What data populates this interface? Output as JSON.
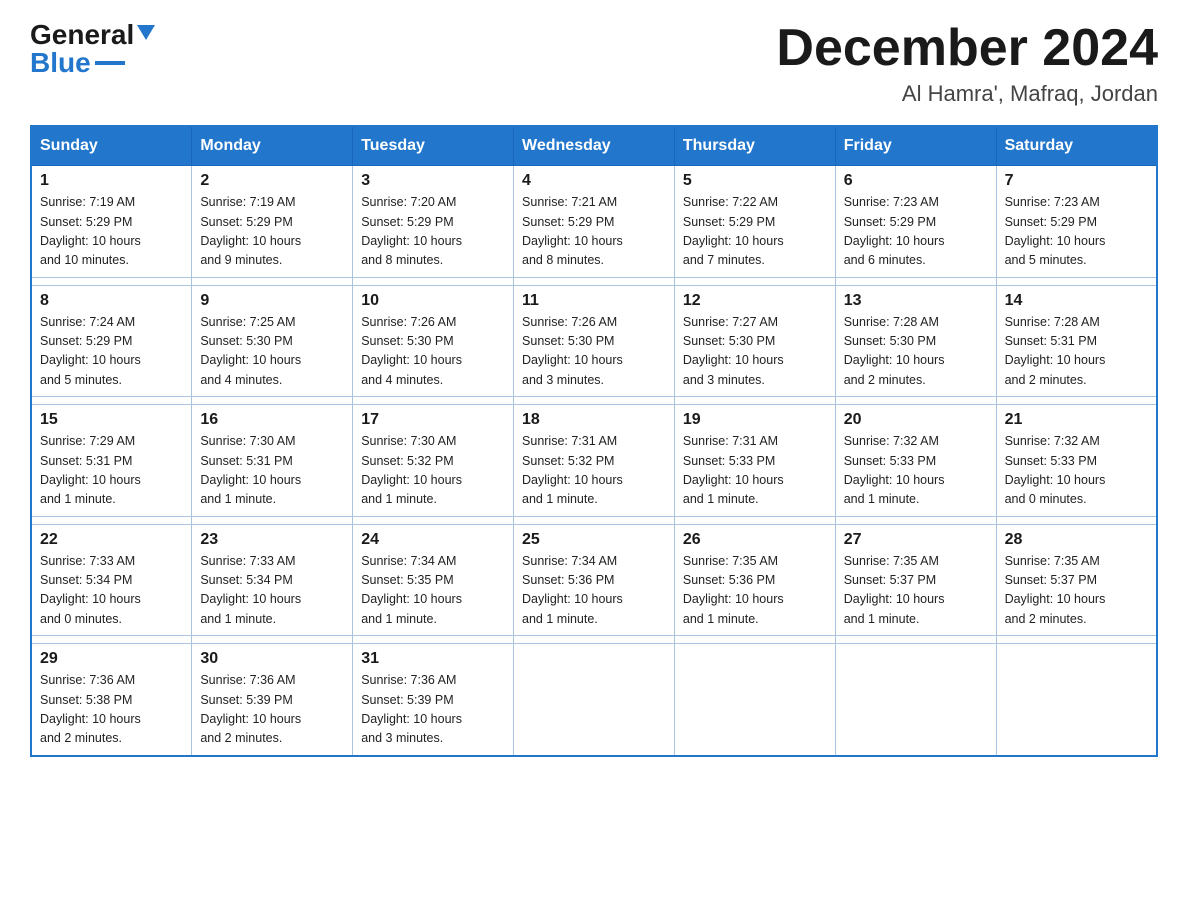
{
  "header": {
    "logo_general": "General",
    "logo_blue": "Blue",
    "title": "December 2024",
    "location": "Al Hamra', Mafraq, Jordan"
  },
  "days_of_week": [
    "Sunday",
    "Monday",
    "Tuesday",
    "Wednesday",
    "Thursday",
    "Friday",
    "Saturday"
  ],
  "weeks": [
    [
      {
        "day": "1",
        "sunrise": "7:19 AM",
        "sunset": "5:29 PM",
        "daylight": "10 hours and 10 minutes."
      },
      {
        "day": "2",
        "sunrise": "7:19 AM",
        "sunset": "5:29 PM",
        "daylight": "10 hours and 9 minutes."
      },
      {
        "day": "3",
        "sunrise": "7:20 AM",
        "sunset": "5:29 PM",
        "daylight": "10 hours and 8 minutes."
      },
      {
        "day": "4",
        "sunrise": "7:21 AM",
        "sunset": "5:29 PM",
        "daylight": "10 hours and 8 minutes."
      },
      {
        "day": "5",
        "sunrise": "7:22 AM",
        "sunset": "5:29 PM",
        "daylight": "10 hours and 7 minutes."
      },
      {
        "day": "6",
        "sunrise": "7:23 AM",
        "sunset": "5:29 PM",
        "daylight": "10 hours and 6 minutes."
      },
      {
        "day": "7",
        "sunrise": "7:23 AM",
        "sunset": "5:29 PM",
        "daylight": "10 hours and 5 minutes."
      }
    ],
    [
      {
        "day": "8",
        "sunrise": "7:24 AM",
        "sunset": "5:29 PM",
        "daylight": "10 hours and 5 minutes."
      },
      {
        "day": "9",
        "sunrise": "7:25 AM",
        "sunset": "5:30 PM",
        "daylight": "10 hours and 4 minutes."
      },
      {
        "day": "10",
        "sunrise": "7:26 AM",
        "sunset": "5:30 PM",
        "daylight": "10 hours and 4 minutes."
      },
      {
        "day": "11",
        "sunrise": "7:26 AM",
        "sunset": "5:30 PM",
        "daylight": "10 hours and 3 minutes."
      },
      {
        "day": "12",
        "sunrise": "7:27 AM",
        "sunset": "5:30 PM",
        "daylight": "10 hours and 3 minutes."
      },
      {
        "day": "13",
        "sunrise": "7:28 AM",
        "sunset": "5:30 PM",
        "daylight": "10 hours and 2 minutes."
      },
      {
        "day": "14",
        "sunrise": "7:28 AM",
        "sunset": "5:31 PM",
        "daylight": "10 hours and 2 minutes."
      }
    ],
    [
      {
        "day": "15",
        "sunrise": "7:29 AM",
        "sunset": "5:31 PM",
        "daylight": "10 hours and 1 minute."
      },
      {
        "day": "16",
        "sunrise": "7:30 AM",
        "sunset": "5:31 PM",
        "daylight": "10 hours and 1 minute."
      },
      {
        "day": "17",
        "sunrise": "7:30 AM",
        "sunset": "5:32 PM",
        "daylight": "10 hours and 1 minute."
      },
      {
        "day": "18",
        "sunrise": "7:31 AM",
        "sunset": "5:32 PM",
        "daylight": "10 hours and 1 minute."
      },
      {
        "day": "19",
        "sunrise": "7:31 AM",
        "sunset": "5:33 PM",
        "daylight": "10 hours and 1 minute."
      },
      {
        "day": "20",
        "sunrise": "7:32 AM",
        "sunset": "5:33 PM",
        "daylight": "10 hours and 1 minute."
      },
      {
        "day": "21",
        "sunrise": "7:32 AM",
        "sunset": "5:33 PM",
        "daylight": "10 hours and 0 minutes."
      }
    ],
    [
      {
        "day": "22",
        "sunrise": "7:33 AM",
        "sunset": "5:34 PM",
        "daylight": "10 hours and 0 minutes."
      },
      {
        "day": "23",
        "sunrise": "7:33 AM",
        "sunset": "5:34 PM",
        "daylight": "10 hours and 1 minute."
      },
      {
        "day": "24",
        "sunrise": "7:34 AM",
        "sunset": "5:35 PM",
        "daylight": "10 hours and 1 minute."
      },
      {
        "day": "25",
        "sunrise": "7:34 AM",
        "sunset": "5:36 PM",
        "daylight": "10 hours and 1 minute."
      },
      {
        "day": "26",
        "sunrise": "7:35 AM",
        "sunset": "5:36 PM",
        "daylight": "10 hours and 1 minute."
      },
      {
        "day": "27",
        "sunrise": "7:35 AM",
        "sunset": "5:37 PM",
        "daylight": "10 hours and 1 minute."
      },
      {
        "day": "28",
        "sunrise": "7:35 AM",
        "sunset": "5:37 PM",
        "daylight": "10 hours and 2 minutes."
      }
    ],
    [
      {
        "day": "29",
        "sunrise": "7:36 AM",
        "sunset": "5:38 PM",
        "daylight": "10 hours and 2 minutes."
      },
      {
        "day": "30",
        "sunrise": "7:36 AM",
        "sunset": "5:39 PM",
        "daylight": "10 hours and 2 minutes."
      },
      {
        "day": "31",
        "sunrise": "7:36 AM",
        "sunset": "5:39 PM",
        "daylight": "10 hours and 3 minutes."
      },
      null,
      null,
      null,
      null
    ]
  ],
  "labels": {
    "sunrise": "Sunrise:",
    "sunset": "Sunset:",
    "daylight": "Daylight:"
  }
}
